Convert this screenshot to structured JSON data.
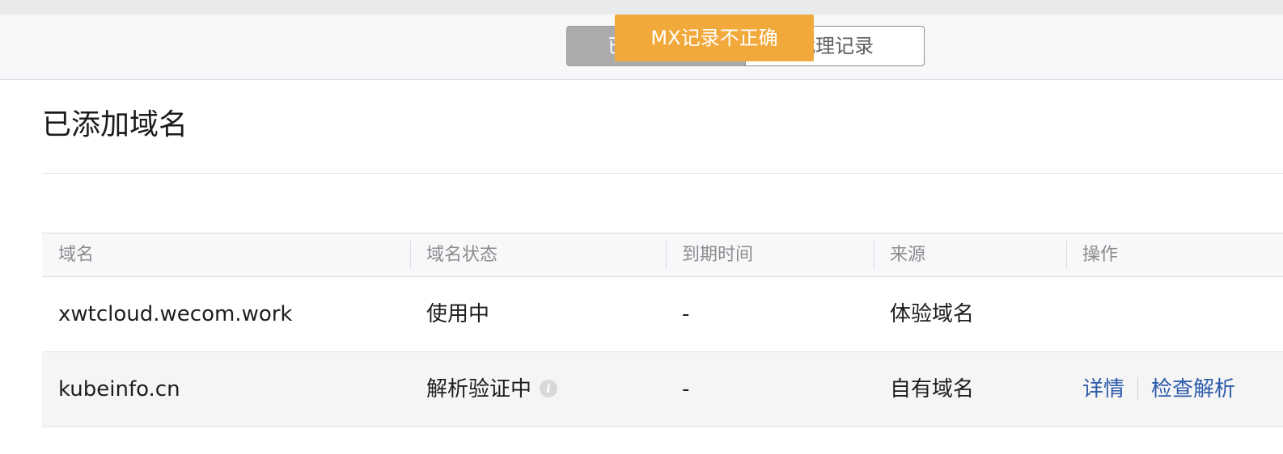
{
  "header": {
    "segments": [
      {
        "label": "已添加域名",
        "active": true
      },
      {
        "label": "代理记录",
        "active": false
      }
    ],
    "toast": "MX记录不正确"
  },
  "section_title": "已添加域名",
  "table": {
    "columns": [
      "域名",
      "域名状态",
      "到期时间",
      "来源",
      "操作"
    ],
    "rows": [
      {
        "domain": "xwtcloud.wecom.work",
        "status": "使用中",
        "expiry": "-",
        "source": "体验域名",
        "actions": []
      },
      {
        "domain": "kubeinfo.cn",
        "status": "解析验证中",
        "status_icon": "info-icon",
        "expiry": "-",
        "source": "自有域名",
        "actions": [
          "详情",
          "检查解析"
        ]
      }
    ]
  },
  "colors": {
    "toast_bg": "#f2a93b",
    "link": "#2d5bab",
    "segment_active_bg": "#ababab"
  }
}
